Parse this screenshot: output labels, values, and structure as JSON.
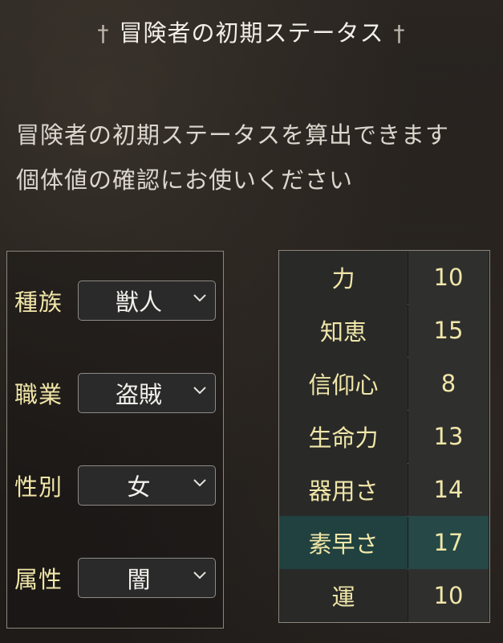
{
  "header": {
    "title": "冒険者の初期ステータス",
    "left_ornament": "†",
    "right_ornament": "†"
  },
  "intro": {
    "line1": "冒険者の初期ステータスを算出できます",
    "line2": "個体値の確認にお使いください"
  },
  "selectors": [
    {
      "label": "種族",
      "value": "獣人"
    },
    {
      "label": "職業",
      "value": "盗賊"
    },
    {
      "label": "性別",
      "value": "女"
    },
    {
      "label": "属性",
      "value": "闇"
    }
  ],
  "stats": [
    {
      "name": "力",
      "value": "10"
    },
    {
      "name": "知恵",
      "value": "15"
    },
    {
      "name": "信仰心",
      "value": "8"
    },
    {
      "name": "生命力",
      "value": "13"
    },
    {
      "name": "器用さ",
      "value": "14"
    },
    {
      "name": "素早さ",
      "value": "17",
      "highlighted": true
    },
    {
      "name": "運",
      "value": "10"
    }
  ],
  "colors": {
    "label_gold": "#f0e6a8",
    "highlight_teal": "#20413f",
    "background": "#221e1b"
  }
}
